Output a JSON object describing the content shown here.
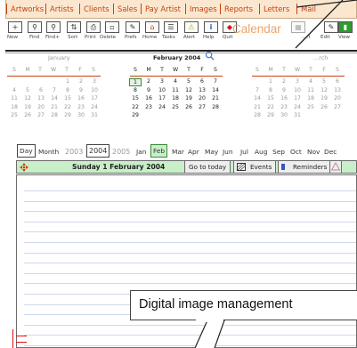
{
  "menu": [
    "Artworks",
    "Artists",
    "Clients",
    "Sales",
    "Pay Artist",
    "Images",
    "Reports",
    "Letters",
    "Mail"
  ],
  "toolbar": {
    "left": [
      "New",
      "Find",
      "Find+",
      "Sort",
      "Print",
      "Delete",
      "Prefs",
      "Home",
      "Tasks",
      "Alert",
      "Help",
      "Quit"
    ],
    "brand": "Calendar",
    "right": [
      "...rt",
      "Edit",
      "View"
    ]
  },
  "months": {
    "jan": {
      "title": "January",
      "dow": [
        "S",
        "M",
        "T",
        "W",
        "T",
        "F",
        "S"
      ],
      "weeks": [
        [
          "",
          "",
          "",
          "",
          "1",
          "2",
          "3"
        ],
        [
          "4",
          "5",
          "6",
          "7",
          "8",
          "9",
          "10"
        ],
        [
          "11",
          "12",
          "13",
          "14",
          "15",
          "16",
          "17"
        ],
        [
          "18",
          "19",
          "20",
          "21",
          "22",
          "23",
          "24"
        ],
        [
          "25",
          "26",
          "27",
          "28",
          "29",
          "30",
          "31"
        ]
      ]
    },
    "feb": {
      "title": "February 2004",
      "dow": [
        "S",
        "M",
        "T",
        "W",
        "T",
        "F",
        "S"
      ],
      "weeks": [
        [
          "1",
          "2",
          "3",
          "4",
          "5",
          "6",
          "7"
        ],
        [
          "8",
          "9",
          "10",
          "11",
          "12",
          "13",
          "14"
        ],
        [
          "15",
          "16",
          "17",
          "18",
          "19",
          "20",
          "21"
        ],
        [
          "22",
          "23",
          "24",
          "25",
          "26",
          "27",
          "28"
        ],
        [
          "29",
          "",
          "",
          "",
          "",
          "",
          ""
        ]
      ],
      "today": "1"
    },
    "mar": {
      "title": "...rch",
      "dow": [
        "S",
        "M",
        "T",
        "W",
        "T",
        "F",
        "S"
      ],
      "weeks": [
        [
          "",
          "1",
          "2",
          "3",
          "4",
          "5",
          "6"
        ],
        [
          "7",
          "8",
          "9",
          "10",
          "11",
          "12",
          "13"
        ],
        [
          "14",
          "15",
          "16",
          "17",
          "18",
          "19",
          "20"
        ],
        [
          "21",
          "22",
          "23",
          "24",
          "25",
          "26",
          "27"
        ],
        [
          "28",
          "29",
          "30",
          "31",
          "",
          "",
          ""
        ]
      ]
    }
  },
  "nav": {
    "view": "Day",
    "view2": "Month",
    "years": [
      "2003",
      "2004",
      "2005"
    ],
    "months": [
      "Jan",
      "Feb",
      "Mar",
      "Apr",
      "May",
      "Jun",
      "Jul",
      "Aug",
      "Sep",
      "Oct",
      "Nov",
      "Dec"
    ],
    "selected_month": "Feb"
  },
  "dayview": {
    "title": "Sunday 1 February 2004",
    "goto": "Go to today",
    "events": "Events",
    "reminders": "Reminders"
  },
  "callout": "Digital image management"
}
